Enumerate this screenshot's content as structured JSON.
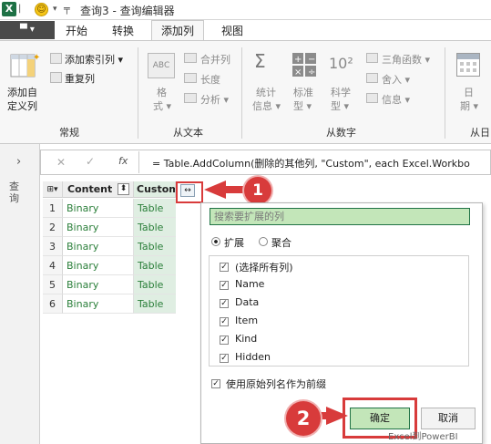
{
  "app": {
    "icon_letter": "X",
    "window_title": "查询3 - 查询编辑器"
  },
  "quick_access": {
    "smile": "☺",
    "dropdown": "▾",
    "more": "╤"
  },
  "tabs": {
    "file_label": "▀ ▾",
    "home": "开始",
    "transform": "转换",
    "add_column": "添加列",
    "view": "视图"
  },
  "ribbon": {
    "general": {
      "add_index": "添加自定义列",
      "add_index_line1": "添加自",
      "add_index_line2": "定义列",
      "add_index_column": "添加索引列 ▾",
      "duplicate_column": "重复列",
      "group_label": "常规"
    },
    "from_text": {
      "format_line1": "格",
      "format_line2": "式 ▾",
      "merge_columns": "合并列",
      "length": "长度",
      "analyze": "分析 ▾",
      "group_label": "从文本",
      "abc_icon": "ABC"
    },
    "from_number": {
      "statistics_line1": "统计",
      "statistics_line2": "信息 ▾",
      "standard_line1": "标准",
      "standard_line2": "型 ▾",
      "scientific_line1": "科学",
      "scientific_line2": "型 ▾",
      "trig": "三角函数 ▾",
      "rounding": "舍入 ▾",
      "information": "信息 ▾",
      "group_label": "从数字",
      "sigma_icon": "Σ",
      "ten_squared": "10²"
    },
    "from_date": {
      "date_line1": "日",
      "date_line2": "期 ▾",
      "group_label": "从日"
    }
  },
  "left_pane": {
    "collapse": "›",
    "queries_label": "查询"
  },
  "formula": {
    "cancel": "✕",
    "confirm": "✓",
    "fx": "fx",
    "text": "= Table.AddColumn(删除的其他列, \"Custom\", each Excel.Workbo"
  },
  "grid": {
    "corner_icon": "⊞▾",
    "columns": [
      "Content",
      "Custom"
    ],
    "col1_icon": "⬍",
    "expand_icon": "↔",
    "rows": [
      {
        "num": "1",
        "content": "Binary",
        "custom": "Table"
      },
      {
        "num": "2",
        "content": "Binary",
        "custom": "Table"
      },
      {
        "num": "3",
        "content": "Binary",
        "custom": "Table"
      },
      {
        "num": "4",
        "content": "Binary",
        "custom": "Table"
      },
      {
        "num": "5",
        "content": "Binary",
        "custom": "Table"
      },
      {
        "num": "6",
        "content": "Binary",
        "custom": "Table"
      }
    ]
  },
  "popup": {
    "search_placeholder": "搜索要扩展的列",
    "expand_label": "扩展",
    "aggregate_label": "聚合",
    "select_all": "(选择所有列)",
    "columns": [
      "Name",
      "Data",
      "Item",
      "Kind",
      "Hidden"
    ],
    "use_prefix": "使用原始列名作为前缀",
    "ok": "确定",
    "cancel": "取消",
    "checkmark": "✓"
  },
  "callouts": {
    "one": "1",
    "two": "2"
  },
  "watermark": "Excel到PowerBI",
  "colors": {
    "highlight": "#d83b3b",
    "green_text": "#2b7f3a",
    "green_fill": "#dfeee2"
  }
}
